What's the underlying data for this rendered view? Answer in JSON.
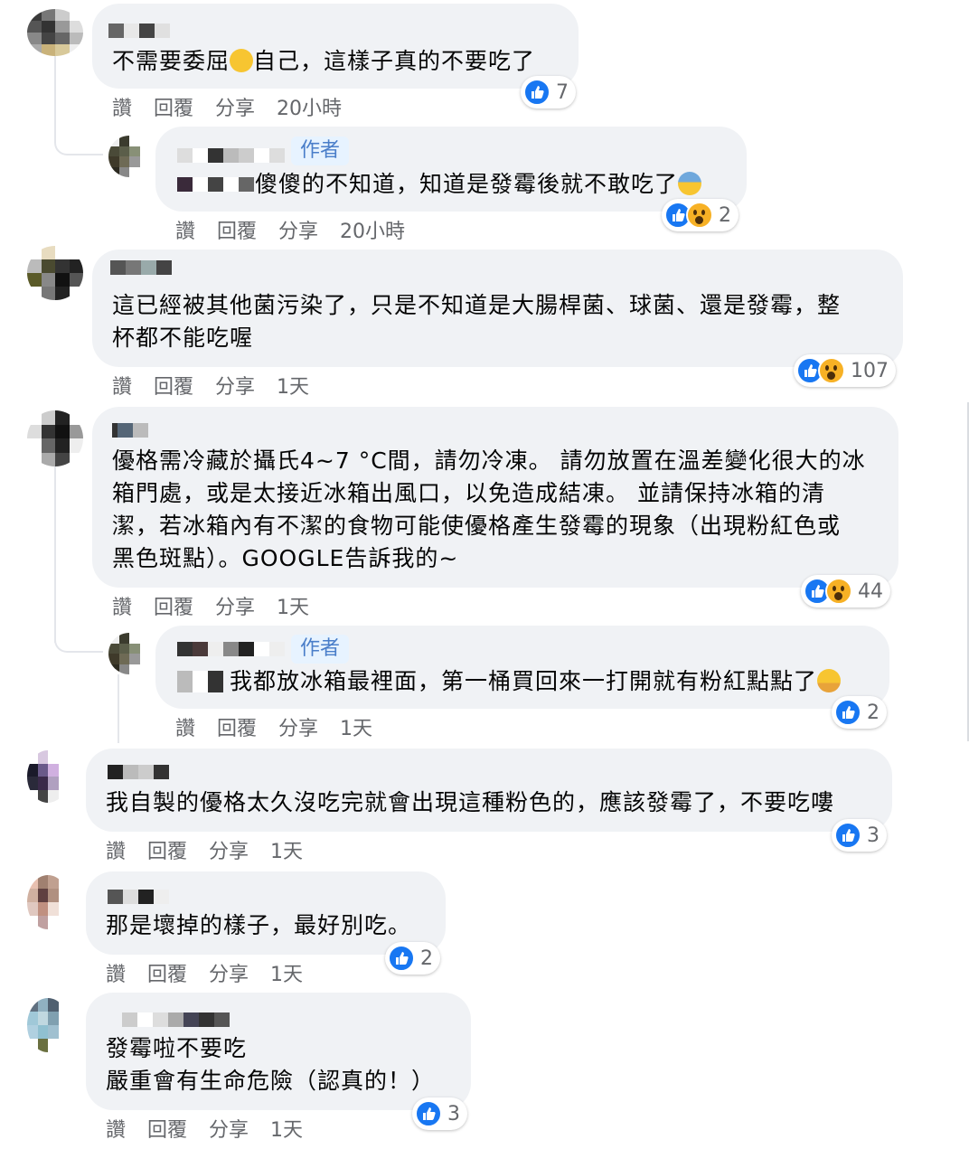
{
  "labels": {
    "like": "讚",
    "reply": "回覆",
    "share": "分享",
    "author": "作者"
  },
  "comments": [
    {
      "text_before": "不需要委屈",
      "emoji": "pleading-face",
      "text_after": "自己，這樣子真的不要吃了",
      "time": "20小時",
      "reactions": [
        "like"
      ],
      "count": "7",
      "reply": {
        "author_badge": "作者",
        "text": "傻傻的不知道，知道是發霉後就不敢吃了",
        "emoji": "anxious-sweat-face",
        "time": "20小時",
        "reactions": [
          "like",
          "wow"
        ],
        "count": "2"
      }
    },
    {
      "text": "這已經被其他菌污染了，只是不知道是大腸桿菌、球菌、還是發霉，整\n杯都不能吃喔",
      "time": "1天",
      "reactions": [
        "like",
        "wow"
      ],
      "count": "107"
    },
    {
      "text": "優格需冷藏於攝氏4~7 °C間，請勿冷凍。 請勿放置在溫差變化很大的冰\n箱門處，或是太接近冰箱出風口，以免造成結凍。 並請保持冰箱的清\n潔，若冰箱內有不潔的食物可能使優格產生發霉的現象（出現粉紅色或\n黑色斑點）。GOOGLE告訴我的~",
      "time": "1天",
      "reactions": [
        "like",
        "wow"
      ],
      "count": "44",
      "reply": {
        "author_badge": "作者",
        "text": "我都放冰箱最裡面，第一桶買回來一打開就有粉紅點點了",
        "emoji": "crying-face",
        "time": "1天",
        "reactions": [
          "like"
        ],
        "count": "2"
      }
    },
    {
      "text": "我自製的優格太久沒吃完就會出現這種粉色的，應該發霉了，不要吃嘍",
      "time": "1天",
      "reactions": [
        "like"
      ],
      "count": "3"
    },
    {
      "text": "那是壞掉的樣子，最好別吃。",
      "time": "1天",
      "reactions": [
        "like"
      ],
      "count": "2"
    },
    {
      "text": "發霉啦不要吃\n嚴重會有生命危險（認真的！）",
      "time": "1天",
      "reactions": [
        "like"
      ],
      "count": "3"
    }
  ],
  "colors": {
    "like_blue": "#1877f2",
    "wow_yellow": "#f7b125",
    "bubble_gray": "#f0f2f5",
    "meta_gray": "#65676b",
    "badge_bg": "#e7f3ff",
    "badge_text": "#4a7ec9"
  }
}
